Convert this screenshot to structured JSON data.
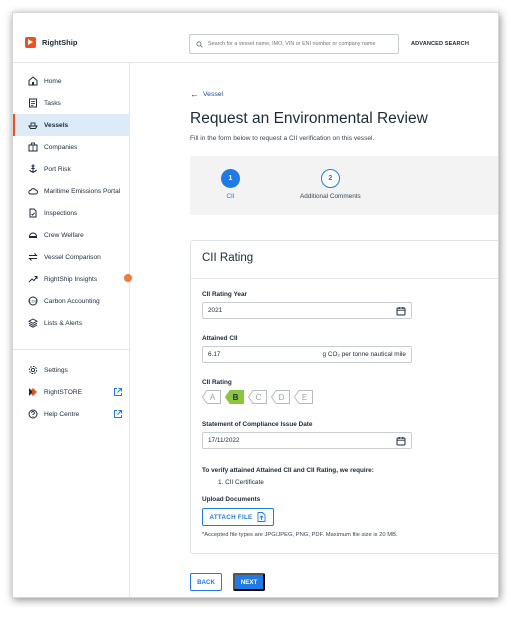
{
  "app": {
    "name": "RightShip"
  },
  "search": {
    "placeholder": "Search for a vessel name, IMO, VIN or ENI number or company name",
    "advanced_label": "ADVANCED SEARCH"
  },
  "sidebar": {
    "items": [
      {
        "label": "Home",
        "icon": "home-icon"
      },
      {
        "label": "Tasks",
        "icon": "tasks-icon"
      },
      {
        "label": "Vessels",
        "icon": "ship-icon",
        "active": true
      },
      {
        "label": "Companies",
        "icon": "building-icon"
      },
      {
        "label": "Port Risk",
        "icon": "anchor-icon"
      },
      {
        "label": "Maritime Emissions Portal",
        "icon": "cloud-icon"
      },
      {
        "label": "Inspections",
        "icon": "inspection-icon"
      },
      {
        "label": "Crew Welfare",
        "icon": "helmet-icon"
      },
      {
        "label": "Vessel Comparison",
        "icon": "compare-icon"
      },
      {
        "label": "RightShip Insights",
        "icon": "trend-icon"
      },
      {
        "label": "Carbon Accounting",
        "icon": "co2-icon"
      },
      {
        "label": "Lists & Alerts",
        "icon": "layers-icon"
      }
    ],
    "bottom": [
      {
        "label": "Settings",
        "icon": "gear-icon"
      },
      {
        "label": "RightSTORE",
        "icon": "store-icon",
        "external": true
      },
      {
        "label": "Help Centre",
        "icon": "help-icon",
        "external": true
      }
    ],
    "notification_color": "#f07a3c"
  },
  "main": {
    "back_label": "Vessel",
    "title": "Request an Environmental Review",
    "subtitle": "Fill in the form below to request a CII verification on this vessel.",
    "steps": [
      {
        "number": "1",
        "label": "CII",
        "active": true
      },
      {
        "number": "2",
        "label": "Additional Comments",
        "active": false
      }
    ]
  },
  "form": {
    "section_title": "CII Rating",
    "year_label": "CII Rating Year",
    "year_value": "2021",
    "attained_label": "Attained CII",
    "attained_value": "6.17",
    "attained_unit": "g CO₂ per tonne nautical mile",
    "rating_label": "CII Rating",
    "ratings": [
      "A",
      "B",
      "C",
      "D",
      "E"
    ],
    "selected_rating": "B",
    "selected_color": "#8cc63f",
    "soc_label": "Statement of Compliance Issue Date",
    "soc_value": "17/11/2022",
    "requirements_title": "To verify attained Attained CII and CII Rating, we require:",
    "requirements": [
      "1. CII Certificate"
    ],
    "upload_label": "Upload Documents",
    "attach_label": "ATTACH FILE",
    "file_note": "*Accepted file types are JPG/JPEG, PNG, PDF. Maximum file size is 20 MB."
  },
  "actions": {
    "back_label": "BACK",
    "next_label": "NEXT"
  },
  "colors": {
    "accent": "#1f7ae6",
    "brand": "#e8531f",
    "active_nav_bg": "#ddebf8"
  }
}
